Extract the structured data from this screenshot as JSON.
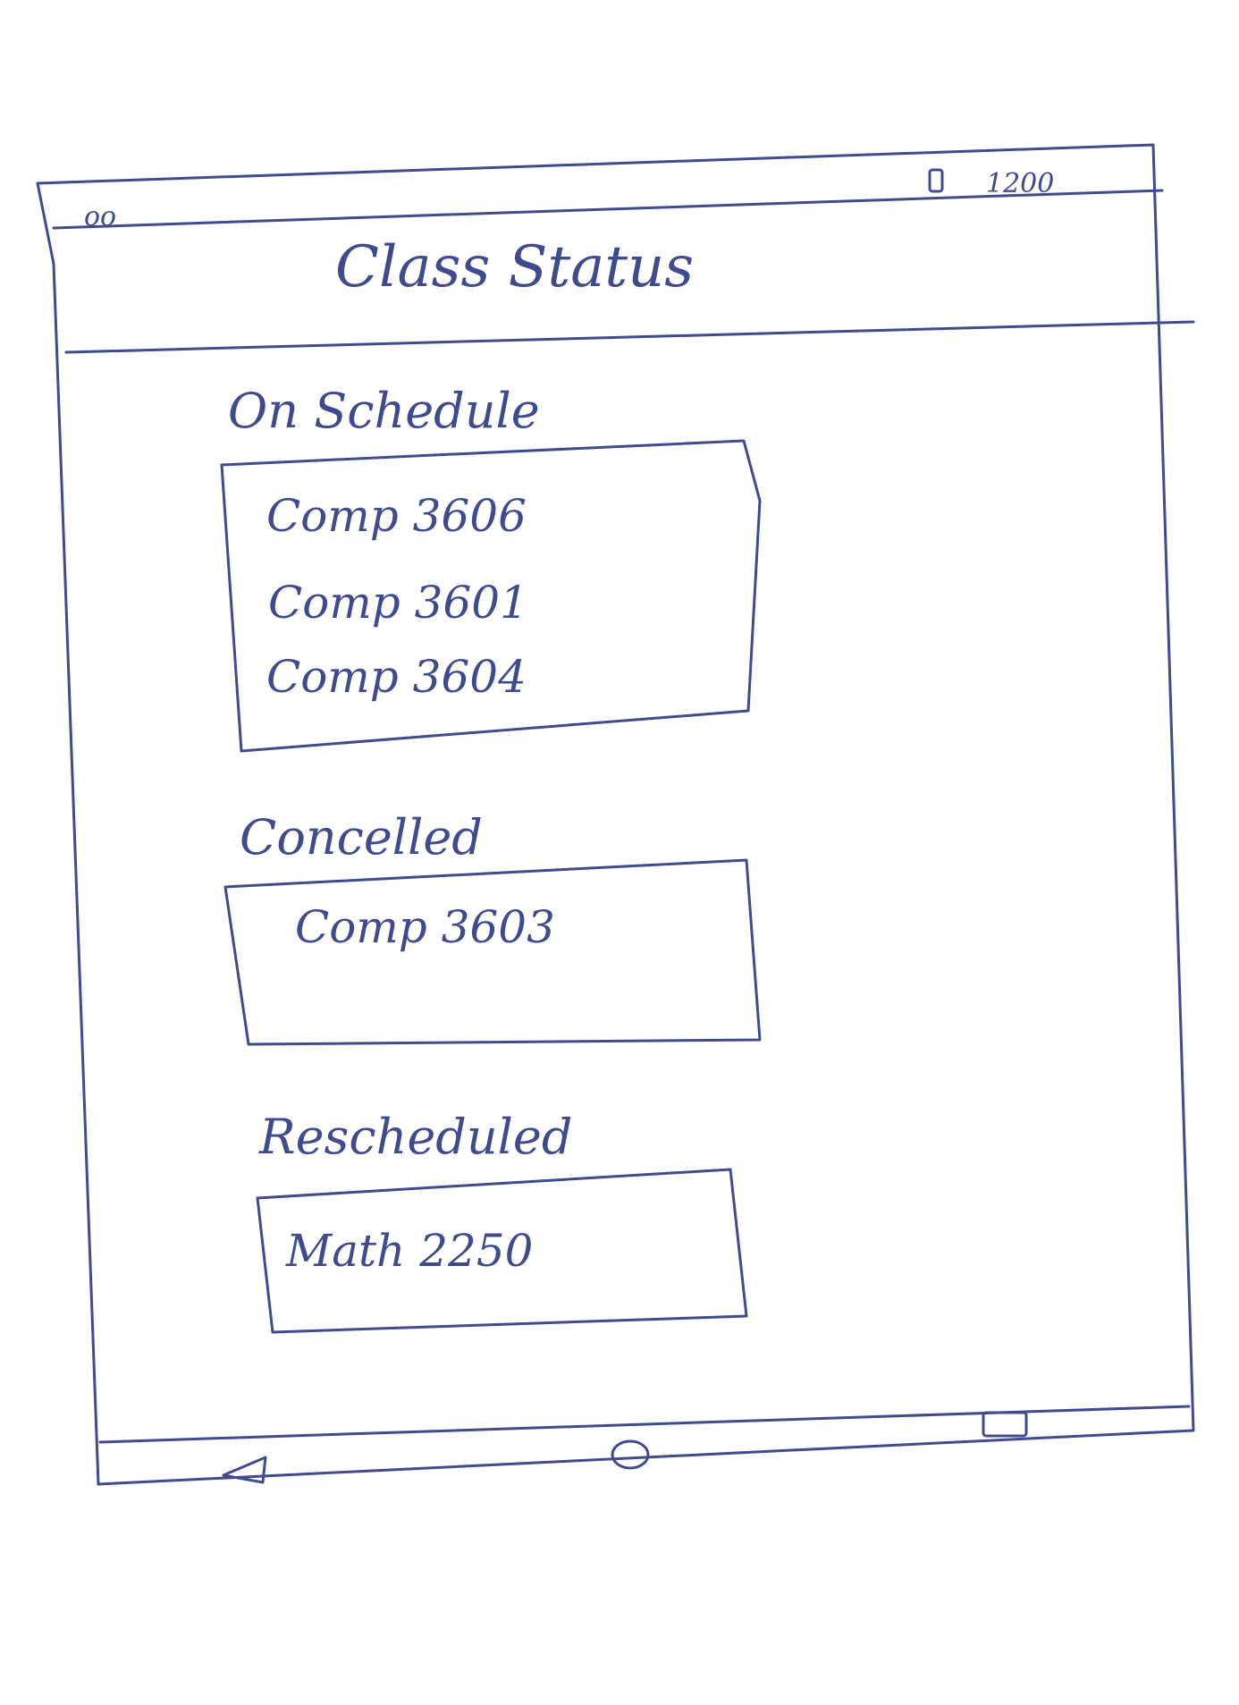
{
  "status_bar": {
    "left_indicator": "oo",
    "time": "1200",
    "battery_icon": "battery-icon"
  },
  "header": {
    "title": "Class Status"
  },
  "sections": [
    {
      "label": "On Schedule",
      "courses": [
        "Comp 3606",
        "Comp 3601",
        "Comp 3604"
      ]
    },
    {
      "label": "Concelled",
      "courses": [
        "Comp 3603"
      ]
    },
    {
      "label": "Rescheduled",
      "courses": [
        "Math 2250"
      ]
    }
  ],
  "nav_bar": {
    "back_icon": "back-triangle-icon",
    "home_icon": "home-circle-icon",
    "recents_icon": "recents-square-icon"
  },
  "colors": {
    "ink": "#3f4b8e",
    "paper": "#ffffff"
  }
}
